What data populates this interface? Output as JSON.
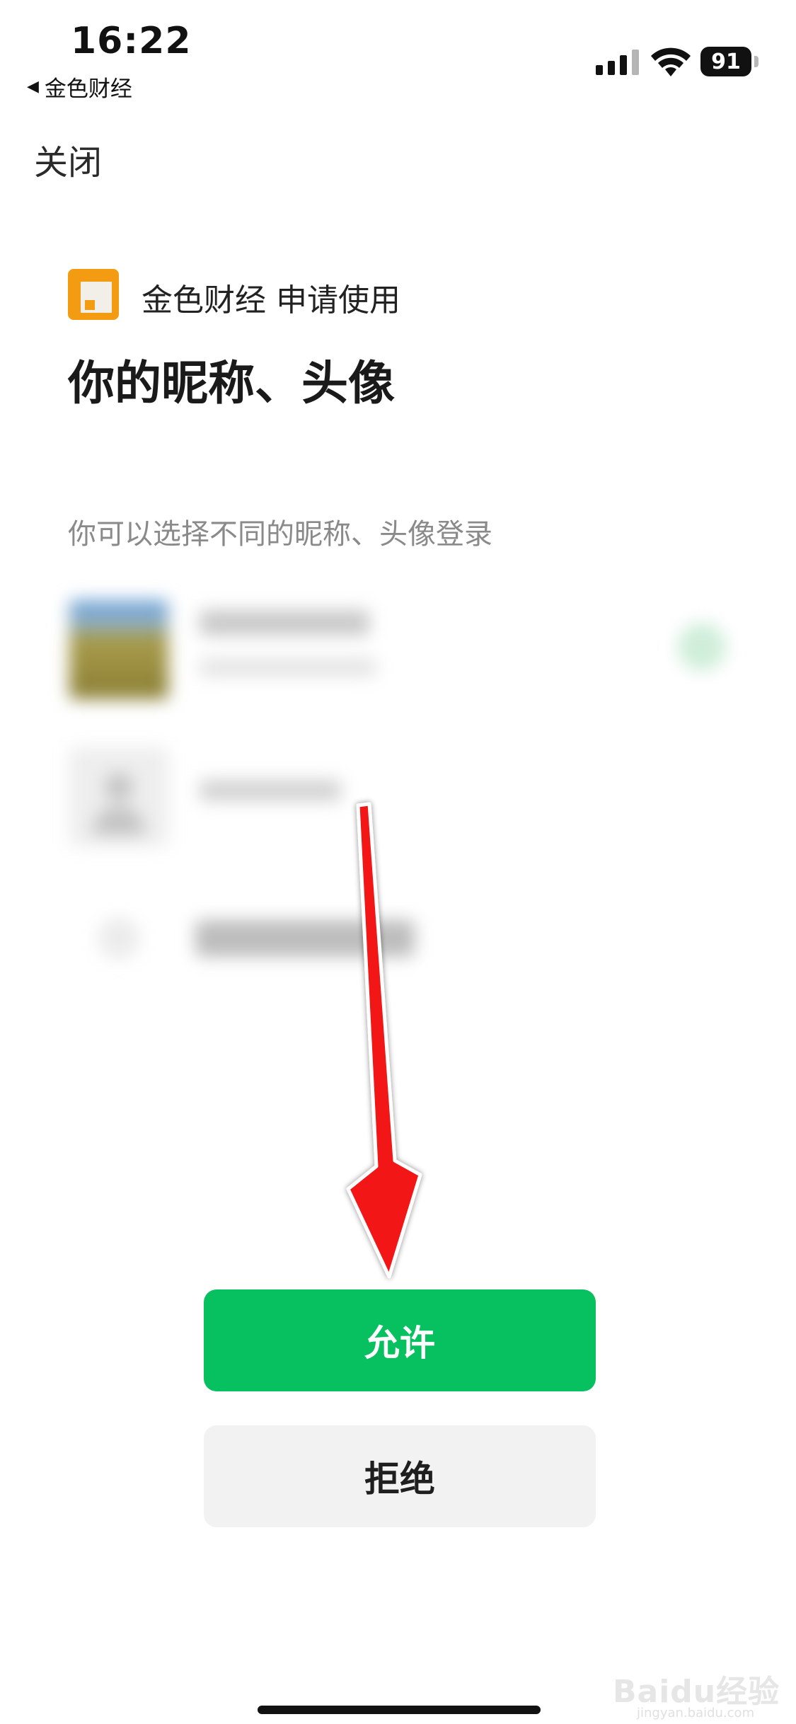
{
  "status_bar": {
    "time": "16:22",
    "back_app": "金色财经",
    "battery": "91"
  },
  "header": {
    "close_label": "关闭"
  },
  "auth": {
    "app_name": "金色财经",
    "request_text": "申请使用",
    "title": "你的昵称、头像",
    "hint": "你可以选择不同的昵称、头像登录"
  },
  "buttons": {
    "allow_label": "允许",
    "reject_label": "拒绝"
  },
  "watermark": {
    "brand": "Baidu经验",
    "url": "jingyan.baidu.com"
  },
  "colors": {
    "accent_green": "#07c160",
    "reject_bg": "#f2f2f2",
    "annotation_arrow": "#ff0000",
    "logo_orange": "#f39c12"
  },
  "icons": {
    "back": "back-triangle-icon",
    "signal": "cellular-signal-icon",
    "wifi": "wifi-icon",
    "battery": "battery-icon",
    "app_logo": "app-logo-icon",
    "arrow": "red-down-arrow-annotation"
  }
}
